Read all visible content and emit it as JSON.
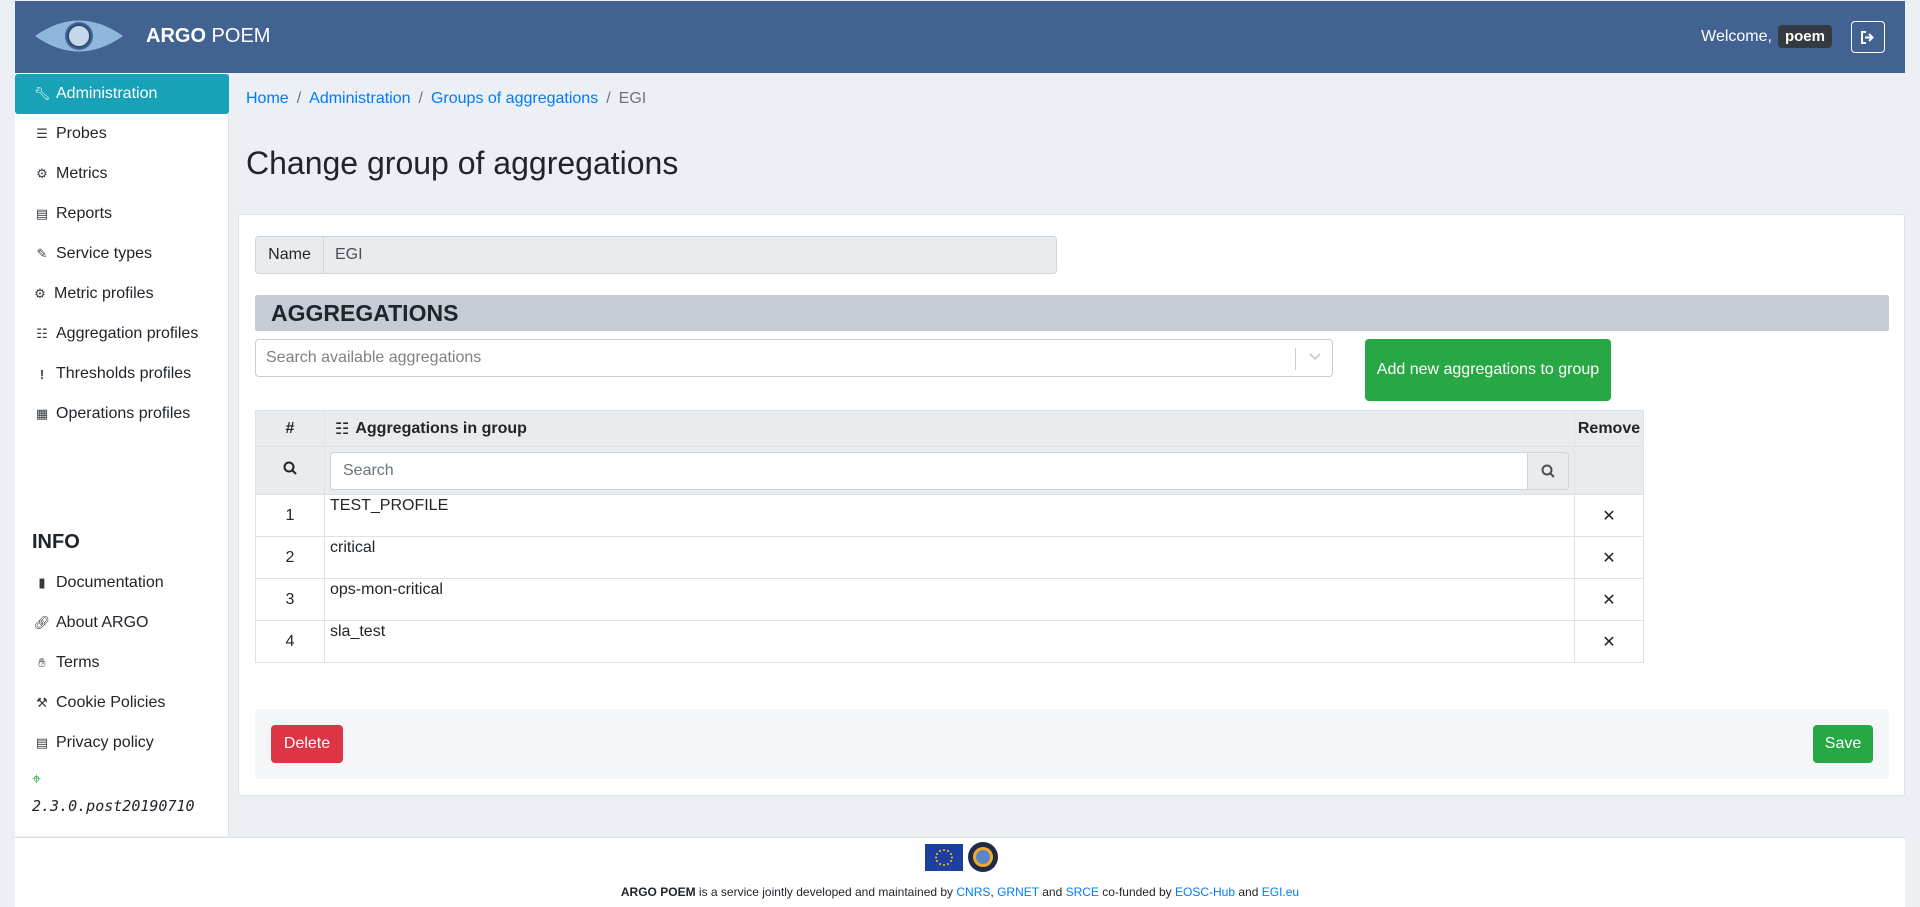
{
  "header": {
    "brand_bold": "ARGO",
    "brand_rest": " POEM",
    "welcome": "Welcome,",
    "username": "poem"
  },
  "sidebar": {
    "items": [
      {
        "label": "Administration",
        "icon": "wrench-icon"
      },
      {
        "label": "Probes",
        "icon": "server-icon"
      },
      {
        "label": "Metrics",
        "icon": "cog-icon"
      },
      {
        "label": "Reports",
        "icon": "file-icon"
      },
      {
        "label": "Service types",
        "icon": "pen-icon"
      },
      {
        "label": "Metric profiles",
        "icon": "cogs-icon"
      },
      {
        "label": "Aggregation profiles",
        "icon": "tasks-icon"
      },
      {
        "label": "Thresholds profiles",
        "icon": "exclamation-icon"
      },
      {
        "label": "Operations profiles",
        "icon": "table-icon"
      }
    ],
    "info_title": "INFO",
    "info_items": [
      {
        "label": "Documentation",
        "icon": "book-icon"
      },
      {
        "label": "About ARGO",
        "icon": "link-icon"
      },
      {
        "label": "Terms",
        "icon": "handshake-icon"
      },
      {
        "label": "Cookie Policies",
        "icon": "gavel-icon"
      },
      {
        "label": "Privacy policy",
        "icon": "list-icon"
      }
    ],
    "version": "2.3.0.post20190710"
  },
  "breadcrumb": {
    "home": "Home",
    "administration": "Administration",
    "groups": "Groups of aggregations",
    "current": "EGI",
    "separator": "/"
  },
  "page_title": "Change group of aggregations",
  "form": {
    "name_label": "Name",
    "name_value": "EGI",
    "section_title": "AGGREGATIONS",
    "select_placeholder": "Search available aggregations",
    "add_button": "Add new aggregations to group",
    "table": {
      "col_num": "#",
      "col_name": "Aggregations in group",
      "col_remove": "Remove",
      "search_placeholder": "Search",
      "rows": [
        {
          "num": "1",
          "name": "TEST_PROFILE"
        },
        {
          "num": "2",
          "name": "critical"
        },
        {
          "num": "3",
          "name": "ops-mon-critical"
        },
        {
          "num": "4",
          "name": "sla_test"
        }
      ],
      "remove_symbol": "✕"
    },
    "delete_button": "Delete",
    "save_button": "Save"
  },
  "footer": {
    "brand": "ARGO POEM",
    "text1": " is a service jointly developed and maintained by ",
    "link_cnrs": "CNRS",
    "comma": ",",
    "link_grnet": "GRNET",
    "and1": " and ",
    "link_srce": "SRCE",
    "text2": " co-funded by ",
    "link_eosc": "EOSC-Hub",
    "and2": " and ",
    "link_egi": "EGI.eu"
  }
}
